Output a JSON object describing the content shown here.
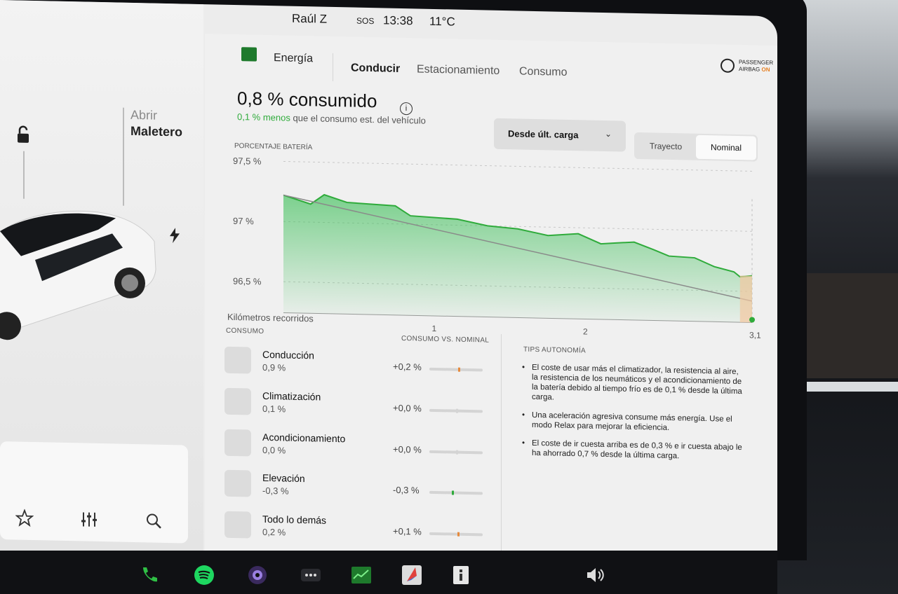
{
  "status": {
    "user": "Raúl Z",
    "sos": "SOS",
    "time": "13:38",
    "temperature": "11°C"
  },
  "car": {
    "trunk_line1": "Abrir",
    "trunk_line2": "Maletero"
  },
  "energy": {
    "app_title": "Energía",
    "tabs": [
      "Conducir",
      "Estacionamiento",
      "Consumo"
    ],
    "active_tab": "Conducir",
    "airbag_line1": "PASSENGER",
    "airbag_line2": "AIRBAG",
    "airbag_state": "ON",
    "headline": "0,8 % consumido",
    "sub_green": "0,1 % menos",
    "sub_rest": " que el consumo est. del vehículo",
    "dropdown_value": "Desde últ. carga",
    "segment": [
      "Trayecto",
      "Nominal"
    ],
    "segment_selected": "Nominal",
    "consumo_header": "CONSUMO",
    "vs_header": "CONSUMO VS. NOMINAL",
    "tips_header": "TIPS AUTONOMÍA",
    "rows": [
      {
        "name": "Conducción",
        "pct": "0,9 %",
        "delta": "+0,2 %",
        "fraction": 0.54,
        "mark_color": "#e68a3c"
      },
      {
        "name": "Climatización",
        "pct": "0,1 %",
        "delta": "+0,0 %",
        "fraction": 0.5,
        "mark_color": "#d4d4d4"
      },
      {
        "name": "Acondicionamiento",
        "pct": "0,0 %",
        "delta": "+0,0 %",
        "fraction": 0.5,
        "mark_color": "#d4d4d4"
      },
      {
        "name": "Elevación",
        "pct": "-0,3 %",
        "delta": "-0,3 %",
        "fraction": 0.42,
        "mark_color": "#2fab3b"
      },
      {
        "name": "Todo lo demás",
        "pct": "0,2 %",
        "delta": "+0,1 %",
        "fraction": 0.52,
        "mark_color": "#e68a3c"
      }
    ],
    "tips": [
      "El coste de usar más el climatizador, la resistencia al aire, la resistencia de los neumáticos y el acondicionamiento de la batería debido al tiempo frío es de 0,1 % desde la última carga.",
      "Una aceleración agresiva consume más energía. Use el modo Relax para mejorar la eficiencia.",
      "El coste de ir cuesta arriba es de 0,3 % e ir cuesta abajo le ha ahorrado 0,7 % desde la última carga."
    ]
  },
  "dock_icons": [
    "phone-icon",
    "spotify-icon",
    "camera-icon",
    "more-icon",
    "energy-icon",
    "navigation-icon",
    "manual-icon",
    "volume-icon"
  ],
  "chart_data": {
    "type": "line",
    "title": "",
    "ylabel": "PORCENTAJE BATERÍA",
    "xlabel": "Kilómetros recorridos",
    "ylim": [
      96.3,
      97.5
    ],
    "xlim": [
      0,
      3.1
    ],
    "y_ticks": [
      "97,5 %",
      "97 %",
      "96,5 %"
    ],
    "y_tick_values": [
      97.5,
      97.0,
      96.5
    ],
    "x_ticks": [
      "1",
      "2",
      "3,1"
    ],
    "x_tick_values": [
      1,
      2,
      3.1
    ],
    "series": [
      {
        "name": "",
        "color": "#2fab3b",
        "x": [
          0,
          0.18,
          0.27,
          0.42,
          0.74,
          0.84,
          1.15,
          1.35,
          1.55,
          1.75,
          1.95,
          2.1,
          2.2,
          2.32,
          2.45,
          2.55,
          2.72,
          2.85,
          2.98,
          3.02,
          3.1
        ],
        "y": [
          97.22,
          97.15,
          97.23,
          97.17,
          97.15,
          97.07,
          97.05,
          97.0,
          96.98,
          96.93,
          96.95,
          96.87,
          96.88,
          96.89,
          96.83,
          96.78,
          96.77,
          96.7,
          96.66,
          96.62,
          96.63
        ]
      },
      {
        "name": "",
        "color": "#8a8a8a",
        "x": [
          0,
          3.1
        ],
        "y": [
          97.22,
          96.42
        ]
      }
    ]
  }
}
